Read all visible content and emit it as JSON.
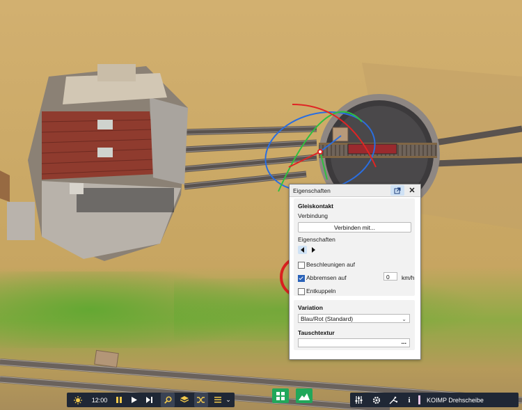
{
  "panel": {
    "title": "Eigenschaften",
    "section_track_contact": "Gleiskontakt",
    "connection_label": "Verbindung",
    "connect_button": "Verbinden mit...",
    "properties_label": "Eigenschaften",
    "checkboxes": [
      {
        "label": "Beschleunigen auf",
        "checked": false
      },
      {
        "label": "Abbremsen auf",
        "checked": true
      },
      {
        "label": "Entkuppeln",
        "checked": false
      }
    ],
    "speed_value": "0",
    "speed_unit": "km/h",
    "section_variation": "Variation",
    "variation_value": "Blau/Rot (Standard)",
    "section_texture": "Tauschtextur",
    "texture_button": "..."
  },
  "toolbar": {
    "time": "12:00",
    "object_name": "KOIMP Drehscheibe"
  },
  "icons": {
    "weather": "sun-icon",
    "pause": "pause-icon",
    "play": "play-icon",
    "skip": "skip-icon",
    "search": "search-icon",
    "layers": "layers-icon",
    "shuffle": "shuffle-icon",
    "list": "list-icon",
    "grid": "grid-icon",
    "terrain": "terrain-icon",
    "mixer": "mixer-icon",
    "settings": "gear-icon",
    "tools": "tools-icon",
    "info": "info-icon"
  },
  "colors": {
    "accent_blue": "#2a62b8",
    "toolbar_bg": "#1f2735",
    "toolbar_accent": "#f2c94c",
    "green_button": "#21a75a",
    "annotation_circle": "#d9201f"
  }
}
